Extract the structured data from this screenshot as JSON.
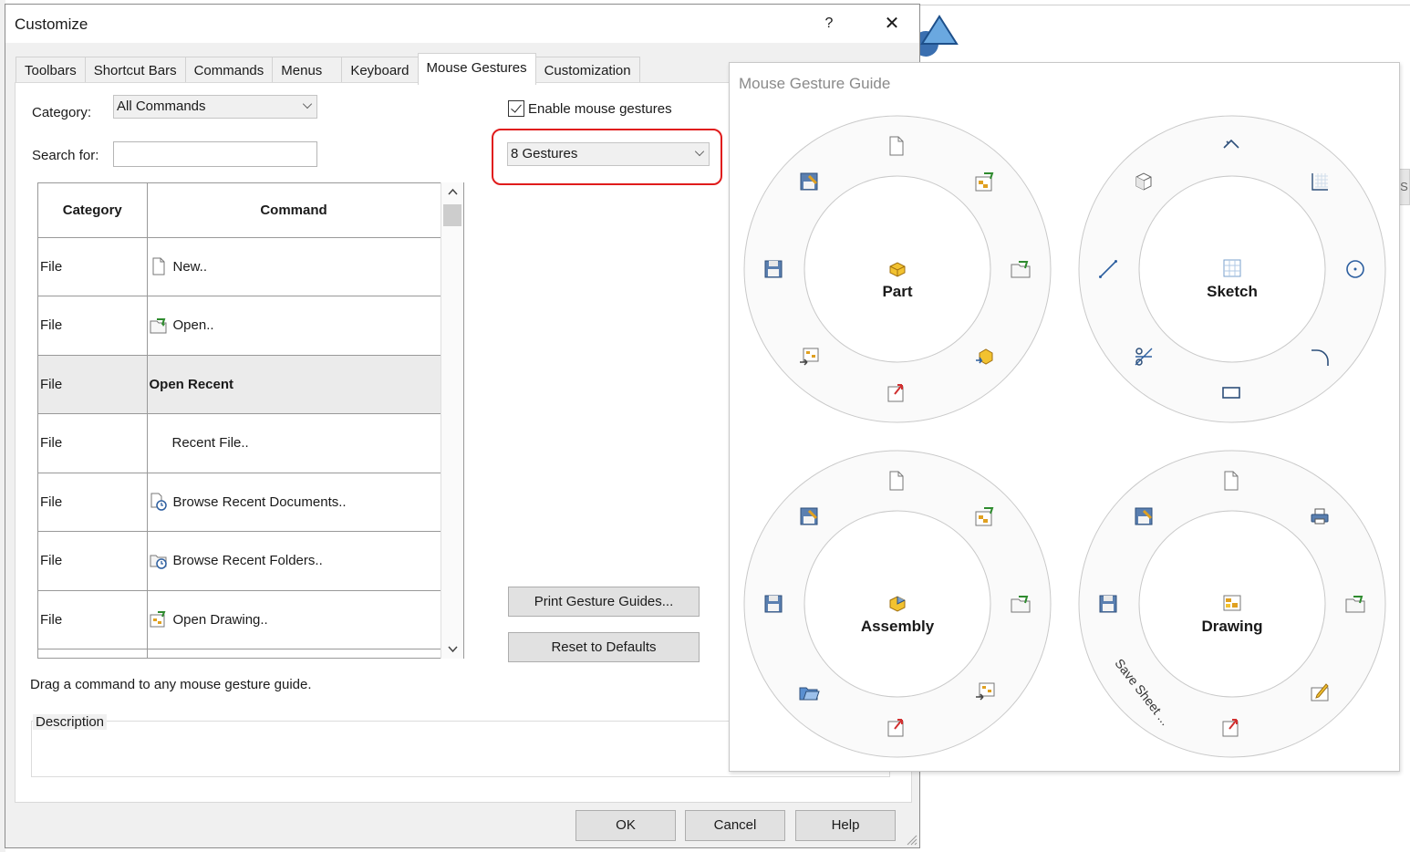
{
  "dialog": {
    "title": "Customize",
    "help_glyph": "?",
    "close_glyph": "✕",
    "tabs": [
      {
        "label": "Toolbars"
      },
      {
        "label": "Shortcut Bars"
      },
      {
        "label": "Commands"
      },
      {
        "label": "Menus"
      },
      {
        "label": "Keyboard"
      },
      {
        "label": "Mouse Gestures",
        "active": true
      },
      {
        "label": "Customization"
      }
    ],
    "category_label": "Category:",
    "category_value": "All Commands",
    "search_label": "Search for:",
    "search_value": "",
    "grid": {
      "headers": [
        "Category",
        "Command"
      ],
      "rows": [
        {
          "category": "File",
          "command": "New..",
          "icon": "new-document-icon"
        },
        {
          "category": "File",
          "command": "Open..",
          "icon": "open-folder-icon"
        },
        {
          "category": "File",
          "command": "Open Recent",
          "selected": true
        },
        {
          "category": "File",
          "command": "Recent File.."
        },
        {
          "category": "File",
          "command": "Browse Recent Documents..",
          "icon": "recent-documents-icon"
        },
        {
          "category": "File",
          "command": "Browse Recent Folders..",
          "icon": "recent-folders-icon"
        },
        {
          "category": "File",
          "command": "Open Drawing..",
          "icon": "open-drawing-icon"
        }
      ]
    },
    "enable_gestures_label": "Enable mouse gestures",
    "enable_gestures_checked": true,
    "gestures_value": "8 Gestures",
    "print_button": "Print Gesture Guides...",
    "reset_button": "Reset to Defaults",
    "drag_hint": "Drag a command to any mouse gesture guide.",
    "description_label": "Description",
    "ok_button": "OK",
    "cancel_button": "Cancel",
    "help_button": "Help"
  },
  "guide": {
    "title": "Mouse Gesture Guide",
    "wheels": [
      {
        "label": "Part",
        "center_icon": "part-icon",
        "slots": [
          "new-document-icon",
          "open-folder-icon",
          "rebuild-icon",
          "make-drawing-icon",
          "options-icon",
          "save-icon",
          "make-drawing-icon",
          "open-drawing-icon"
        ]
      },
      {
        "label": "Sketch",
        "center_icon": "sketch-grid-icon",
        "slots": [
          "dimension-icon",
          "grid-icon",
          "circle-icon",
          "arc-icon",
          "rectangle-icon",
          "trim-icon",
          "line-icon",
          "view-cube-icon"
        ]
      },
      {
        "label": "Assembly",
        "center_icon": "assembly-icon",
        "slots": [
          "new-document-icon",
          "open-drawing-icon",
          "open-folder-icon",
          "make-drawing-icon",
          "options-icon",
          "open-file-icon",
          "save-icon",
          "make-drawing-icon"
        ]
      },
      {
        "label": "Drawing",
        "center_icon": "drawing-icon",
        "slots": [
          "new-document-icon",
          "print-icon",
          "open-folder-icon",
          "edit-sheet-icon",
          "options-icon",
          "",
          "save-icon",
          "make-drawing-icon"
        ],
        "slot_text": "Save Sheet ..."
      }
    ]
  },
  "background": {
    "side_tab_letter": "S"
  }
}
